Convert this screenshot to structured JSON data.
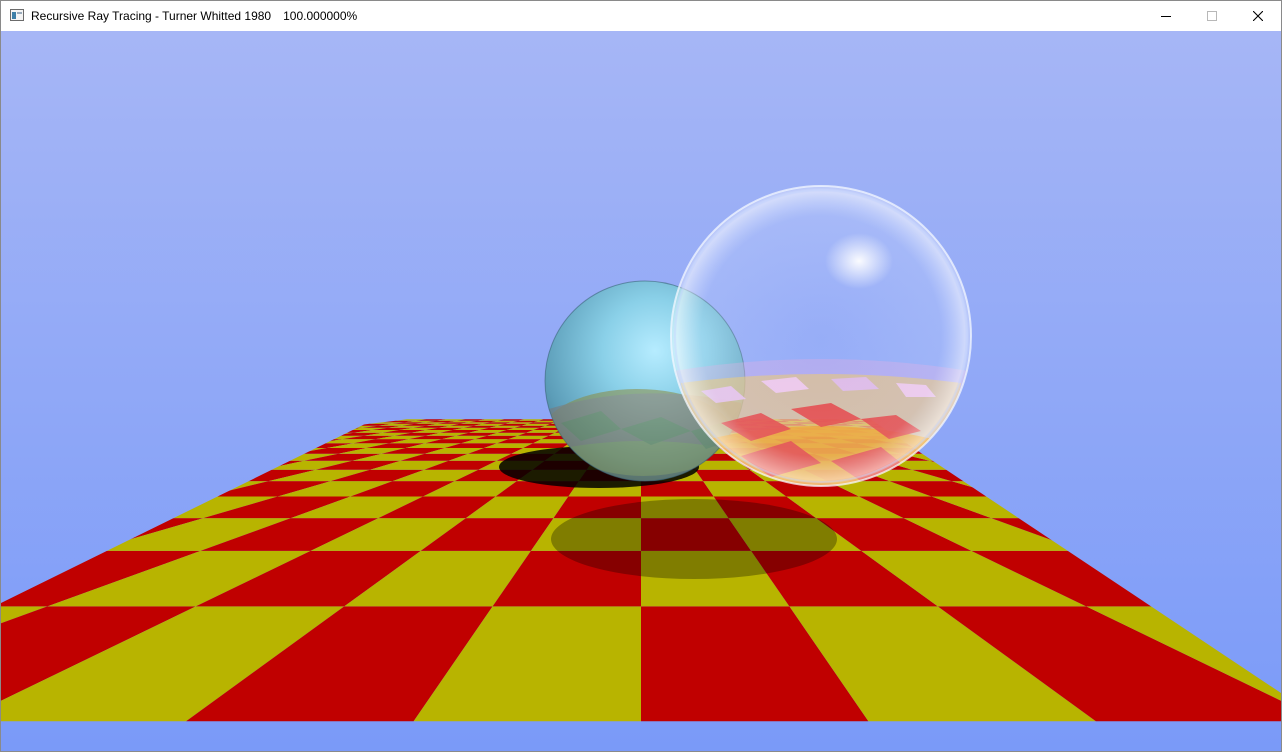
{
  "window": {
    "title": "Recursive Ray Tracing - Turner Whitted 1980",
    "progress": "100.000000%",
    "controls": {
      "minimize_icon": "minimize-icon",
      "maximize_icon": "maximize-icon",
      "close_icon": "close-icon"
    }
  },
  "scene": {
    "sky_top_color": "#a6b6f6",
    "sky_bottom_color": "#7a9af8",
    "floor_color_a": "#c00000",
    "floor_color_b": "#b8b400",
    "opaque_sphere_color": "#8ad0e8",
    "glass_sphere_tint": "#dcecff"
  }
}
